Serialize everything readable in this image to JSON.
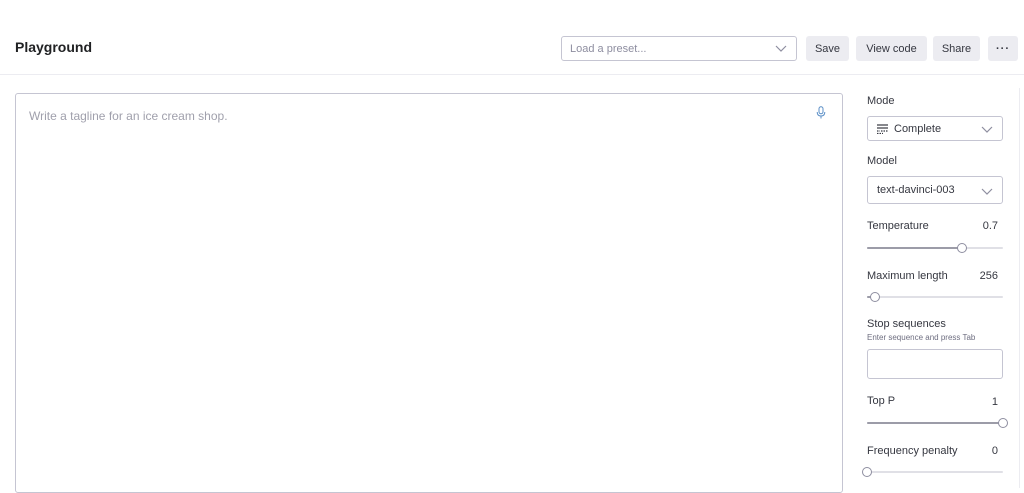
{
  "header": {
    "title": "Playground",
    "preset_placeholder": "Load a preset...",
    "save_label": "Save",
    "view_code_label": "View code",
    "share_label": "Share",
    "more_label": "···"
  },
  "editor": {
    "placeholder": "Write a tagline for an ice cream shop.",
    "mic_icon": "microphone-icon"
  },
  "sidebar": {
    "mode": {
      "label": "Mode",
      "value": "Complete",
      "icon": "complete-mode-icon"
    },
    "model": {
      "label": "Model",
      "value": "text-davinci-003"
    },
    "temperature": {
      "label": "Temperature",
      "value": "0.7",
      "fraction": 0.7
    },
    "max_length": {
      "label": "Maximum length",
      "value": "256",
      "fraction": 0.06
    },
    "stop_sequences": {
      "label": "Stop sequences",
      "hint": "Enter sequence and press Tab"
    },
    "top_p": {
      "label": "Top P",
      "value": "1",
      "fraction": 1.0
    },
    "frequency_penalty": {
      "label": "Frequency penalty",
      "value": "0",
      "fraction": 0.0
    }
  },
  "colors": {
    "border": "#c5c5d2",
    "button_bg": "#ececf1",
    "text": "#202123",
    "placeholder": "#a0a0ac",
    "mic": "#5b8fc7"
  }
}
